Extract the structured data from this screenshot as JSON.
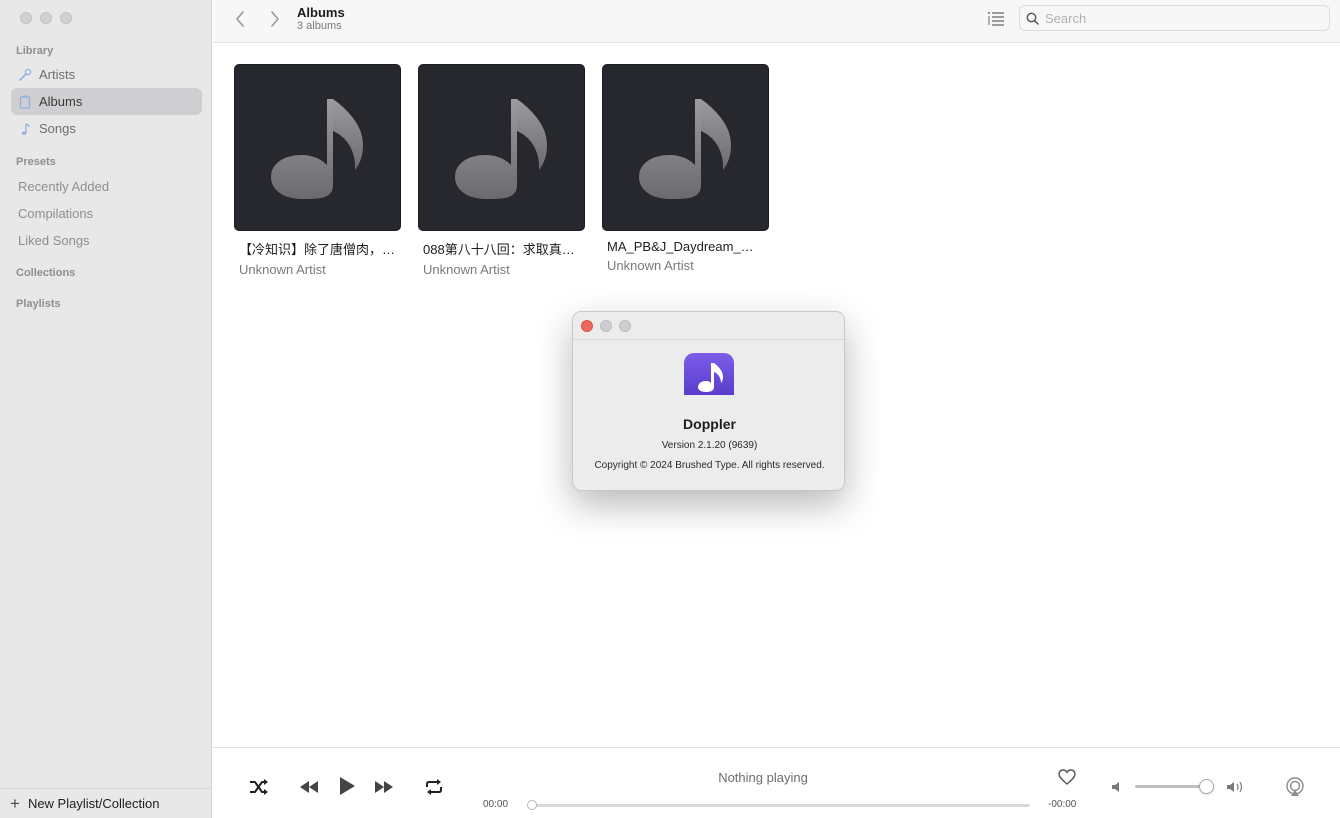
{
  "sidebar": {
    "sections": {
      "library": "Library",
      "presets": "Presets",
      "collections": "Collections",
      "playlists": "Playlists"
    },
    "library_items": [
      {
        "label": "Artists",
        "icon": "microphone-icon"
      },
      {
        "label": "Albums",
        "icon": "album-icon",
        "active": true
      },
      {
        "label": "Songs",
        "icon": "music-note-icon"
      }
    ],
    "presets": [
      "Recently Added",
      "Compilations",
      "Liked Songs"
    ],
    "new_playlist_label": "New Playlist/Collection"
  },
  "toolbar": {
    "title": "Albums",
    "subtitle": "3 albums",
    "search_placeholder": "Search"
  },
  "albums": [
    {
      "title": "【冷知识】除了唐僧肉，…",
      "artist": "Unknown Artist"
    },
    {
      "title": "088第八十八回：求取真…",
      "artist": "Unknown Artist"
    },
    {
      "title": "MA_PB&J_Daydream_M…",
      "artist": "Unknown Artist"
    }
  ],
  "about_dialog": {
    "app_name": "Doppler",
    "version": "Version 2.1.20 (9639)",
    "copyright": "Copyright © 2024 Brushed Type. All rights reserved."
  },
  "player": {
    "now_playing": "Nothing playing",
    "elapsed": "00:00",
    "remaining": "-00:00",
    "progress": 0,
    "volume": 0.9
  },
  "colors": {
    "accent_purple": "#6a4ddb",
    "close_red": "#ed6a5e",
    "cover_bg": "#26282d"
  }
}
